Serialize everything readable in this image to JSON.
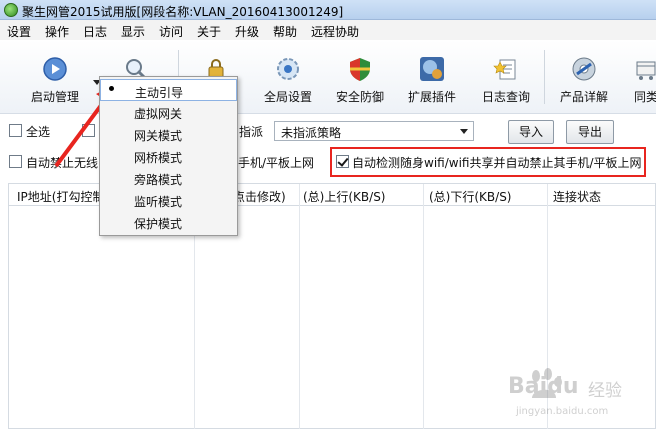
{
  "window": {
    "title": "聚生网管2015试用版[网段名称:VLAN_20160413001249]"
  },
  "menu": [
    "设置",
    "操作",
    "日志",
    "显示",
    "访问",
    "关于",
    "升级",
    "帮助",
    "远程协助"
  ],
  "toolbar": {
    "items": [
      {
        "label": "启动管理",
        "icon": "play-icon"
      },
      {
        "label": "",
        "icon": "magnifier-icon"
      },
      {
        "label": "",
        "icon": "lock-icon"
      },
      {
        "label": "全局设置",
        "icon": "gear-icon"
      },
      {
        "label": "安全防御",
        "icon": "shield-icon"
      },
      {
        "label": "扩展插件",
        "icon": "plugin-icon"
      },
      {
        "label": "日志查询",
        "icon": "log-icon"
      },
      {
        "label": "产品详解",
        "icon": "disc-icon"
      },
      {
        "label": "同类",
        "icon": "cart-icon"
      }
    ]
  },
  "controls": {
    "select_all": "全选",
    "assign_label": "指派",
    "policy_value": "未指派策略",
    "import": "导入",
    "export": "导出",
    "auto_block_prefix": "自动禁止无线",
    "auto_block_suffix": "手机/平板上网",
    "auto_detect": "自动检测随身wifi/wifi共享并自动禁止其手机/平板上网"
  },
  "popup_menu": {
    "selected_index": 0,
    "items": [
      "主动引导",
      "虚拟网关",
      "网关模式",
      "网桥模式",
      "旁路模式",
      "监听模式",
      "保护模式"
    ]
  },
  "table": {
    "columns": [
      "IP地址(打勾控制",
      "点击修改)",
      "(总)上行(KB/S)",
      "(总)下行(KB/S)",
      "连接状态"
    ]
  },
  "watermark": {
    "brand": "Baidu",
    "sub": "经验",
    "url": "jingyan.baidu.com"
  },
  "colors": {
    "highlight": "#e8251f",
    "arrow": "#e8251f"
  }
}
